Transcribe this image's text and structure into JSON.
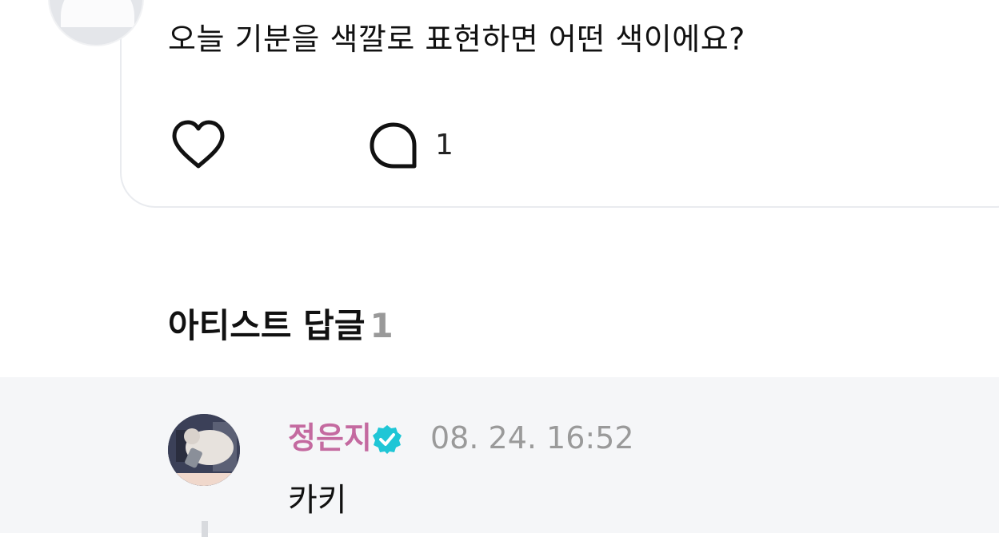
{
  "post": {
    "text": "오늘 기분을 색깔로 표현하면 어떤 색이에요?",
    "comment_count": "1",
    "like_icon": "heart-outline-icon",
    "comment_icon": "speech-bubble-icon"
  },
  "replies_section": {
    "title": "아티스트 답글",
    "count": "1"
  },
  "reply": {
    "author": "정은지",
    "verified_icon": "verified-badge-icon",
    "verified_color": "#1fc6d6",
    "author_color": "#c46aa0",
    "timestamp": "08. 24. 16:52",
    "text": "카키"
  }
}
